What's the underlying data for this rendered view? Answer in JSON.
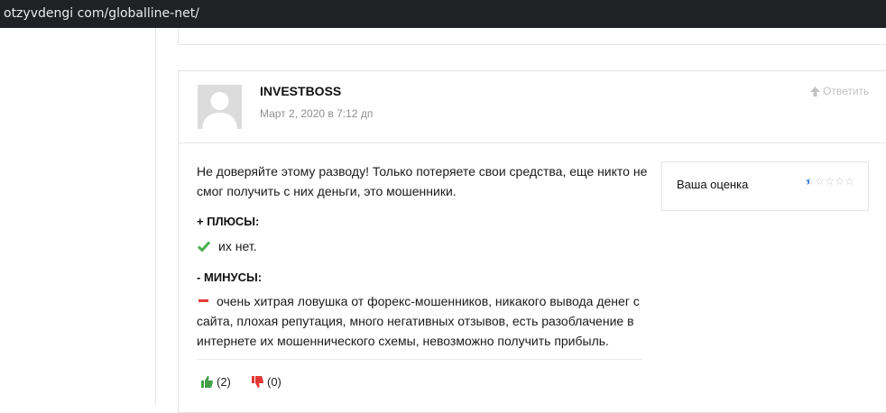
{
  "browser": {
    "url": "otzyvdengi com/globalline-net/"
  },
  "review": {
    "author": "INVESTBOSS",
    "date": "Март 2, 2020 в 7:12 дп",
    "reply_label": "Ответить",
    "body": "Не доверяйте этому разводу! Только потеряете свои средства, еще никто не смог получить с них деньги, это мошенники.",
    "pros_title": "+ ПЛЮСЫ:",
    "pros_text": "их нет.",
    "cons_title": "- МИНУСЫ:",
    "cons_text": "очень хитрая ловушка от форекс-мошенников, никакого вывода денег с сайта, плохая репутация, много негативных отзывов, есть разоблачение в интернете их мошеннического схемы, невозможно получить прибыль.",
    "likes": "(2)",
    "dislikes": "(0)"
  },
  "rating": {
    "label": "Ваша оценка",
    "value": 0.5,
    "max": 5
  },
  "icons": {
    "reply": "arrow-up-icon",
    "pros": "checkmark-icon",
    "cons": "minus-icon",
    "like": "thumbs-up-icon",
    "dislike": "thumbs-down-icon",
    "avatar": "user-silhouette-icon"
  },
  "colors": {
    "browser_bar": "#1f2124",
    "check": "#4caf50",
    "minus": "#e53935",
    "like": "#43a047",
    "dislike": "#e53935",
    "star_fill": "#2f6fd6"
  }
}
